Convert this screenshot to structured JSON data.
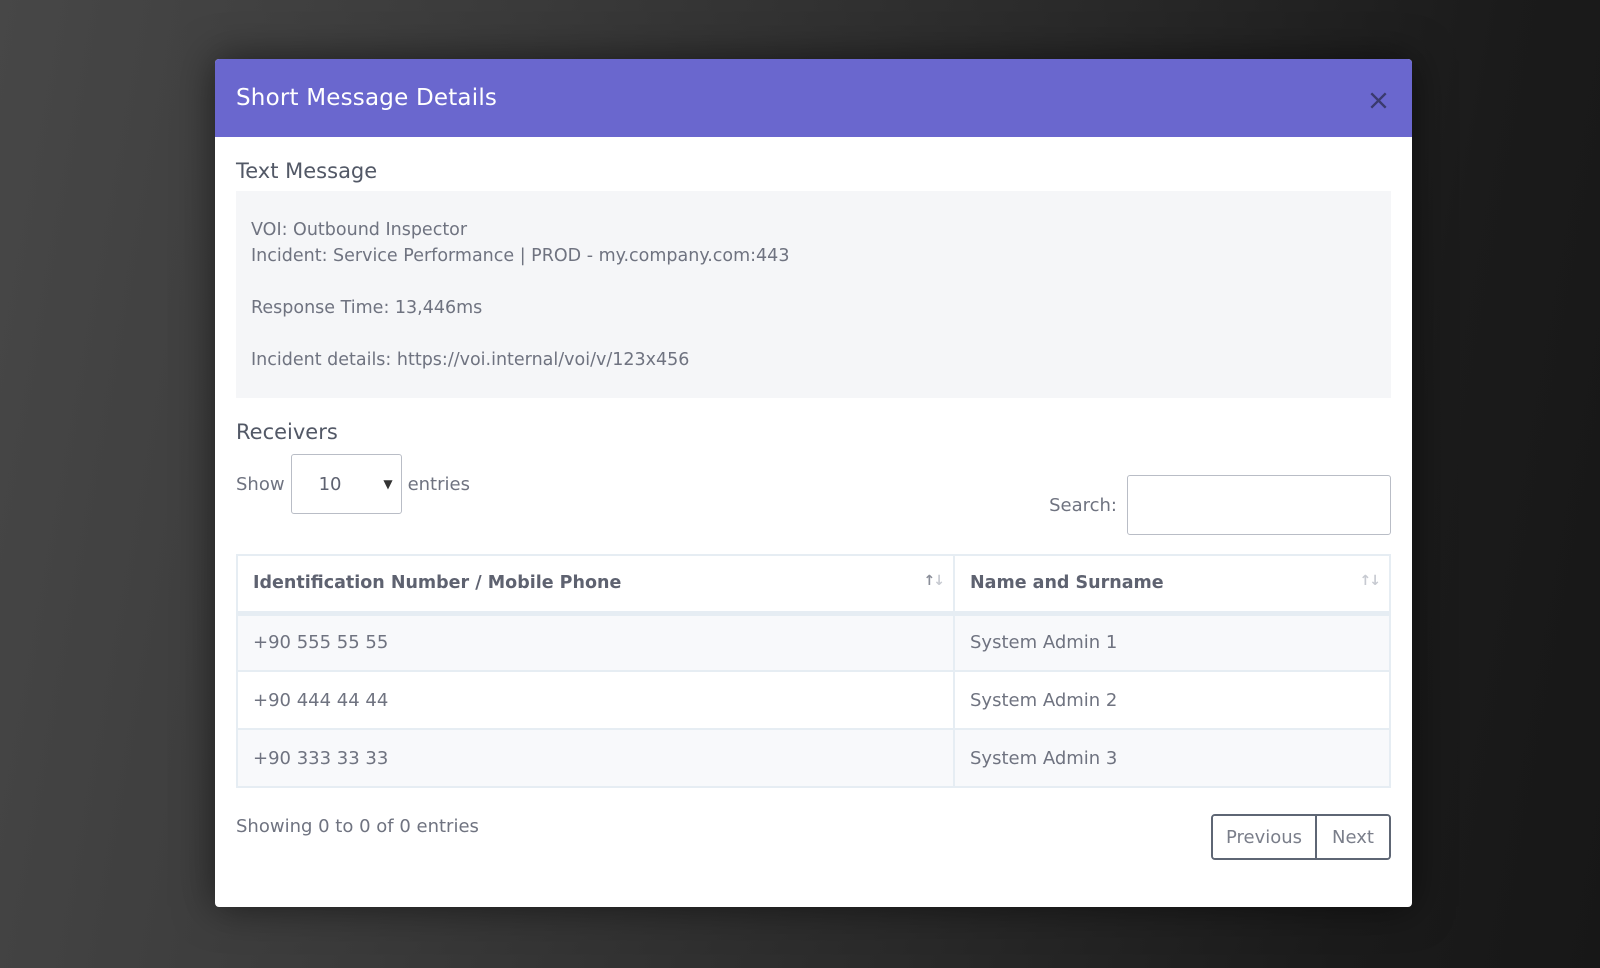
{
  "modal": {
    "title": "Short Message Details",
    "close_icon": "close-icon"
  },
  "text_message": {
    "section_title": "Text Message",
    "lines": [
      "VOI: Outbound Inspector",
      "Incident: Service Performance | PROD - my.company.com:443",
      "",
      "Response Time: 13,446ms",
      "",
      "Incident details: https://voi.internal/voi/v/123x456"
    ]
  },
  "receivers": {
    "section_title": "Receivers",
    "length": {
      "show_label": "Show",
      "selected": "10",
      "entries_label": "entries",
      "arrow_icon": "caret-down-icon"
    },
    "search": {
      "label": "Search:",
      "value": "",
      "placeholder": ""
    },
    "columns": [
      {
        "label": "Identification Number / Mobile Phone",
        "sort_icon": "sort-icon",
        "sorted": "ascending"
      },
      {
        "label": "Name and Surname",
        "sort_icon": "sort-icon",
        "sorted": "none"
      }
    ],
    "rows": [
      {
        "id": "+90 555 55 55",
        "name": "System Admin 1"
      },
      {
        "id": "+90 444 44 44",
        "name": "System Admin 2"
      },
      {
        "id": "+90 333 33 33",
        "name": "System Admin 3"
      }
    ],
    "info": "Showing 0 to 0 of 0 entries",
    "pagination": {
      "previous_label": "Previous",
      "next_label": "Next"
    }
  },
  "colors": {
    "header_bg": "#6a67ce",
    "header_text": "#ffffff",
    "close_icon": "#3a3a6e",
    "message_bg": "#f5f6f8",
    "text": "#6f7380",
    "table_border": "#e6edf3",
    "pagination_border": "#5e6674"
  }
}
